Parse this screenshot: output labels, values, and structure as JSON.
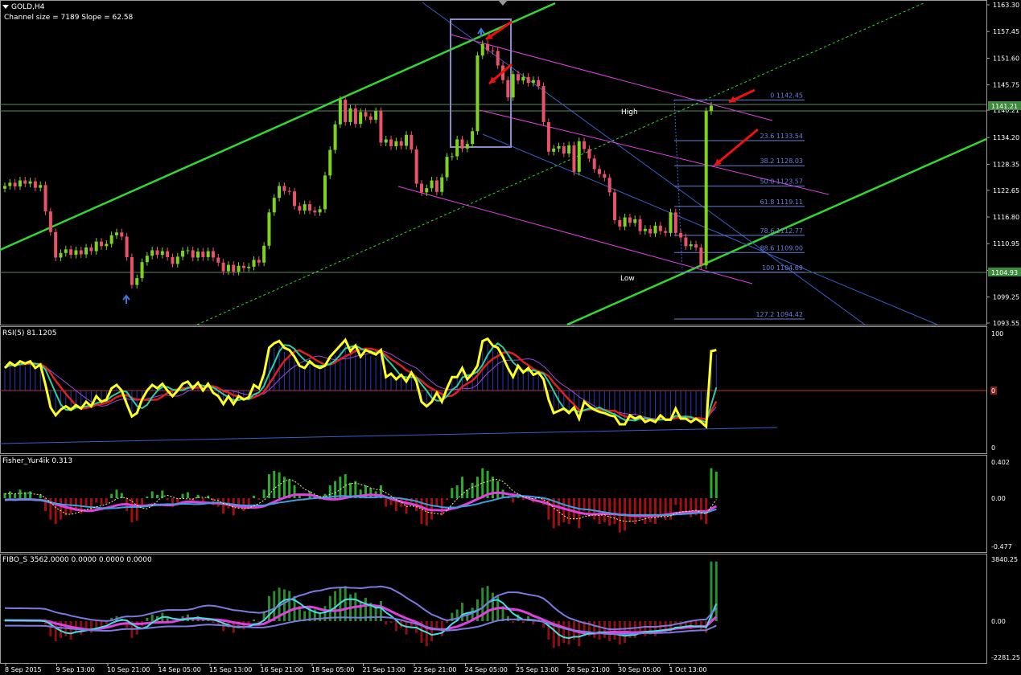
{
  "header": {
    "symbol": "GOLD,H4",
    "channel_info": "Channel size = 7189 Slope = 62.58"
  },
  "panels": {
    "rsi": {
      "title": "RSI(5) 81.1205",
      "ticks": [
        "100",
        "0"
      ],
      "mid_tag": "0"
    },
    "fisher": {
      "title": "Fisher_Yur4ik 0.313",
      "ticks": [
        "0.402",
        "0.00",
        "-0.477"
      ]
    },
    "fibo": {
      "title": "FIBO_S 3562.0000 0.0000 0.0000 0.0000",
      "ticks": [
        "3840.25",
        "0.00",
        "-2281.25"
      ]
    }
  },
  "price_labels": {
    "high": "High",
    "low": "Low",
    "current_tag": "1141.21",
    "low_tag": "1104.93"
  },
  "colors": {
    "bull": "#7ed31f",
    "bear": "#e8536a",
    "channel": "#31d831",
    "grid_line": "#5a8a5a",
    "rsi_main": "#ffff20",
    "fib": "#6a7fd8",
    "magenta": "#e040e0"
  },
  "chart_data": {
    "type": "line",
    "price_axis": {
      "ticks": [
        "1163.30",
        "1157.45",
        "1151.60",
        "1145.75",
        "1140.21",
        "1134.20",
        "1128.35",
        "1122.65",
        "1116.80",
        "1110.95",
        "1105.10",
        "1099.25",
        "1093.55"
      ],
      "ylim": [
        1093.55,
        1163.3
      ]
    },
    "time_axis": [
      "8 Sep 2015",
      "9 Sep 13:00",
      "10 Sep 21:00",
      "14 Sep 05:00",
      "15 Sep 13:00",
      "16 Sep 21:00",
      "18 Sep 05:00",
      "21 Sep 13:00",
      "22 Sep 21:00",
      "24 Sep 05:00",
      "25 Sep 13:00",
      "28 Sep 21:00",
      "30 Sep 05:00",
      "1 Oct 13:00"
    ],
    "fib_levels": [
      {
        "label": "0 1142.45",
        "value": 1142.45
      },
      {
        "label": "23.6 1133.54",
        "value": 1133.54
      },
      {
        "label": "38.2 1128.03",
        "value": 1128.03
      },
      {
        "label": "50.0 1123.57",
        "value": 1123.57
      },
      {
        "label": "61.8 1119.11",
        "value": 1119.11
      },
      {
        "label": "78.6 1112.77",
        "value": 1112.77
      },
      {
        "label": "88.6 1109.00",
        "value": 1109.0
      },
      {
        "label": "100 1104.69",
        "value": 1104.69
      },
      {
        "label": "127.2 1094.42",
        "value": 1094.42
      }
    ],
    "candles": [
      {
        "o": 1123.0,
        "c": 1123.6
      },
      {
        "o": 1123.6,
        "c": 1124.3
      },
      {
        "o": 1124.3,
        "c": 1123.5
      },
      {
        "o": 1123.5,
        "c": 1124.8
      },
      {
        "o": 1124.8,
        "c": 1124.1
      },
      {
        "o": 1124.1,
        "c": 1124.6
      },
      {
        "o": 1124.6,
        "c": 1123.2
      },
      {
        "o": 1123.2,
        "c": 1123.8
      },
      {
        "o": 1123.8,
        "c": 1118.0
      },
      {
        "o": 1118.0,
        "c": 1113.5
      },
      {
        "o": 1113.5,
        "c": 1107.9
      },
      {
        "o": 1107.9,
        "c": 1108.9
      },
      {
        "o": 1108.9,
        "c": 1109.7
      },
      {
        "o": 1109.7,
        "c": 1108.5
      },
      {
        "o": 1108.5,
        "c": 1109.5
      },
      {
        "o": 1109.5,
        "c": 1108.6
      },
      {
        "o": 1108.6,
        "c": 1110.1
      },
      {
        "o": 1110.1,
        "c": 1109.3
      },
      {
        "o": 1109.3,
        "c": 1111.4
      },
      {
        "o": 1111.4,
        "c": 1110.4
      },
      {
        "o": 1110.4,
        "c": 1110.9
      },
      {
        "o": 1110.9,
        "c": 1112.8
      },
      {
        "o": 1112.8,
        "c": 1113.4
      },
      {
        "o": 1113.4,
        "c": 1112.5
      },
      {
        "o": 1112.5,
        "c": 1108.0
      },
      {
        "o": 1108.0,
        "c": 1101.9
      },
      {
        "o": 1101.9,
        "c": 1103.4
      },
      {
        "o": 1103.4,
        "c": 1106.9
      },
      {
        "o": 1106.9,
        "c": 1108.3
      },
      {
        "o": 1108.3,
        "c": 1109.5
      },
      {
        "o": 1109.5,
        "c": 1108.5
      },
      {
        "o": 1108.5,
        "c": 1109.3
      },
      {
        "o": 1109.3,
        "c": 1108.0
      },
      {
        "o": 1108.0,
        "c": 1106.5
      },
      {
        "o": 1106.5,
        "c": 1108.1
      },
      {
        "o": 1108.1,
        "c": 1109.4
      },
      {
        "o": 1109.4,
        "c": 1109.5
      },
      {
        "o": 1109.5,
        "c": 1107.9
      },
      {
        "o": 1107.9,
        "c": 1109.2
      },
      {
        "o": 1109.2,
        "c": 1108.0
      },
      {
        "o": 1108.0,
        "c": 1109.3
      },
      {
        "o": 1109.3,
        "c": 1107.9
      },
      {
        "o": 1107.9,
        "c": 1106.8
      },
      {
        "o": 1106.8,
        "c": 1104.9
      },
      {
        "o": 1104.9,
        "c": 1106.3
      },
      {
        "o": 1106.3,
        "c": 1104.8
      },
      {
        "o": 1104.8,
        "c": 1106.1
      },
      {
        "o": 1106.1,
        "c": 1105.6
      },
      {
        "o": 1105.6,
        "c": 1105.9
      },
      {
        "o": 1105.9,
        "c": 1107.4
      },
      {
        "o": 1107.4,
        "c": 1106.8
      },
      {
        "o": 1106.8,
        "c": 1110.5
      },
      {
        "o": 1110.5,
        "c": 1117.8
      },
      {
        "o": 1117.8,
        "c": 1121.0
      },
      {
        "o": 1121.0,
        "c": 1123.6
      },
      {
        "o": 1123.6,
        "c": 1122.5
      },
      {
        "o": 1122.5,
        "c": 1122.4
      },
      {
        "o": 1122.4,
        "c": 1119.2
      },
      {
        "o": 1119.2,
        "c": 1118.2
      },
      {
        "o": 1118.2,
        "c": 1119.6
      },
      {
        "o": 1119.6,
        "c": 1118.2
      },
      {
        "o": 1118.2,
        "c": 1117.8
      },
      {
        "o": 1117.8,
        "c": 1118.5
      },
      {
        "o": 1118.5,
        "c": 1125.9
      },
      {
        "o": 1125.9,
        "c": 1131.5
      },
      {
        "o": 1131.5,
        "c": 1137.1
      },
      {
        "o": 1137.1,
        "c": 1142.5
      },
      {
        "o": 1142.5,
        "c": 1137.6
      },
      {
        "o": 1137.6,
        "c": 1140.6
      },
      {
        "o": 1140.6,
        "c": 1137.2
      },
      {
        "o": 1137.2,
        "c": 1139.8
      },
      {
        "o": 1139.8,
        "c": 1138.8
      },
      {
        "o": 1138.8,
        "c": 1138.1
      },
      {
        "o": 1138.1,
        "c": 1140.0
      },
      {
        "o": 1140.0,
        "c": 1133.1
      },
      {
        "o": 1133.1,
        "c": 1133.8
      },
      {
        "o": 1133.8,
        "c": 1132.3
      },
      {
        "o": 1132.3,
        "c": 1133.4
      },
      {
        "o": 1133.4,
        "c": 1132.4
      },
      {
        "o": 1132.4,
        "c": 1134.8
      },
      {
        "o": 1134.8,
        "c": 1131.6
      },
      {
        "o": 1131.6,
        "c": 1124.1
      },
      {
        "o": 1124.1,
        "c": 1122.2
      },
      {
        "o": 1122.2,
        "c": 1123.1
      },
      {
        "o": 1123.1,
        "c": 1124.8
      },
      {
        "o": 1124.8,
        "c": 1122.3
      },
      {
        "o": 1122.3,
        "c": 1125.5
      },
      {
        "o": 1125.5,
        "c": 1130.0
      },
      {
        "o": 1130.0,
        "c": 1130.1
      },
      {
        "o": 1130.1,
        "c": 1133.8
      },
      {
        "o": 1133.8,
        "c": 1131.8
      },
      {
        "o": 1131.8,
        "c": 1132.8
      },
      {
        "o": 1132.8,
        "c": 1135.6
      },
      {
        "o": 1135.6,
        "c": 1152.2
      },
      {
        "o": 1152.2,
        "c": 1154.7
      },
      {
        "o": 1154.7,
        "c": 1153.3
      },
      {
        "o": 1153.3,
        "c": 1153.2
      },
      {
        "o": 1153.2,
        "c": 1150.0
      },
      {
        "o": 1150.0,
        "c": 1146.8
      },
      {
        "o": 1146.8,
        "c": 1143.0
      },
      {
        "o": 1143.0,
        "c": 1148.1
      },
      {
        "o": 1148.1,
        "c": 1146.7
      },
      {
        "o": 1146.7,
        "c": 1147.5
      },
      {
        "o": 1147.5,
        "c": 1146.2
      },
      {
        "o": 1146.2,
        "c": 1146.8
      },
      {
        "o": 1146.8,
        "c": 1145.5
      },
      {
        "o": 1145.5,
        "c": 1137.6
      },
      {
        "o": 1137.6,
        "c": 1131.1
      },
      {
        "o": 1131.1,
        "c": 1131.8
      },
      {
        "o": 1131.8,
        "c": 1132.3
      },
      {
        "o": 1132.3,
        "c": 1130.7
      },
      {
        "o": 1130.7,
        "c": 1132.5
      },
      {
        "o": 1132.5,
        "c": 1126.7
      },
      {
        "o": 1126.7,
        "c": 1133.4
      },
      {
        "o": 1133.4,
        "c": 1131.7
      },
      {
        "o": 1131.7,
        "c": 1129.6
      },
      {
        "o": 1129.6,
        "c": 1127.3
      },
      {
        "o": 1127.3,
        "c": 1126.2
      },
      {
        "o": 1126.2,
        "c": 1125.4
      },
      {
        "o": 1125.4,
        "c": 1122.2
      },
      {
        "o": 1122.2,
        "c": 1116.1
      },
      {
        "o": 1116.1,
        "c": 1114.7
      },
      {
        "o": 1114.7,
        "c": 1116.7
      },
      {
        "o": 1116.7,
        "c": 1115.5
      },
      {
        "o": 1115.5,
        "c": 1116.3
      },
      {
        "o": 1116.3,
        "c": 1113.7
      },
      {
        "o": 1113.7,
        "c": 1114.2
      },
      {
        "o": 1114.2,
        "c": 1113.2
      },
      {
        "o": 1113.2,
        "c": 1114.9
      },
      {
        "o": 1114.9,
        "c": 1113.7
      },
      {
        "o": 1113.7,
        "c": 1113.3
      },
      {
        "o": 1113.3,
        "c": 1117.8
      },
      {
        "o": 1117.8,
        "c": 1113.3
      },
      {
        "o": 1113.3,
        "c": 1112.3
      },
      {
        "o": 1112.3,
        "c": 1110.4
      },
      {
        "o": 1110.4,
        "c": 1110.8
      },
      {
        "o": 1110.8,
        "c": 1110.1
      },
      {
        "o": 1110.1,
        "c": 1106.2
      },
      {
        "o": 1106.2,
        "c": 1140.0
      },
      {
        "o": 1140.0,
        "c": 1141.2
      }
    ],
    "rsi": [
      70,
      75,
      72,
      76,
      74,
      76,
      70,
      73,
      55,
      35,
      28,
      33,
      36,
      33,
      37,
      34,
      40,
      36,
      45,
      40,
      42,
      52,
      55,
      50,
      38,
      27,
      30,
      42,
      50,
      55,
      52,
      56,
      50,
      45,
      50,
      56,
      58,
      52,
      57,
      50,
      56,
      48,
      45,
      38,
      45,
      38,
      45,
      42,
      44,
      55,
      52,
      65,
      88,
      92,
      94,
      88,
      86,
      80,
      72,
      70,
      76,
      72,
      70,
      72,
      80,
      85,
      90,
      95,
      85,
      90,
      80,
      86,
      84,
      82,
      86,
      62,
      65,
      60,
      64,
      58,
      66,
      58,
      40,
      36,
      40,
      48,
      40,
      52,
      62,
      62,
      70,
      60,
      65,
      72,
      94,
      96,
      90,
      88,
      80,
      70,
      62,
      72,
      66,
      70,
      64,
      66,
      60,
      42,
      30,
      32,
      34,
      30,
      35,
      25,
      40,
      36,
      33,
      31,
      30,
      28,
      27,
      20,
      20,
      28,
      25,
      27,
      22,
      24,
      22,
      28,
      24,
      24,
      34,
      25,
      25,
      22,
      25,
      22,
      18,
      85,
      86
    ],
    "fisher": {
      "histogram": [
        0.06,
        0.08,
        0.05,
        0.1,
        0.07,
        0.08,
        -0.02,
        0.04,
        -0.15,
        -0.25,
        -0.3,
        -0.25,
        -0.2,
        -0.18,
        -0.15,
        -0.18,
        -0.1,
        -0.14,
        -0.05,
        -0.08,
        -0.06,
        0.05,
        0.1,
        0.06,
        -0.15,
        -0.28,
        -0.26,
        -0.1,
        0.02,
        0.08,
        0.04,
        0.09,
        -0.02,
        -0.1,
        -0.05,
        0.05,
        0.07,
        -0.04,
        0.04,
        -0.06,
        0.03,
        -0.08,
        -0.1,
        -0.18,
        -0.12,
        -0.2,
        -0.12,
        -0.15,
        -0.12,
        0.03,
        -0.02,
        0.1,
        0.28,
        0.32,
        0.3,
        0.25,
        0.22,
        0.15,
        0.05,
        -0.02,
        0.08,
        0.02,
        -0.02,
        0.05,
        0.15,
        0.2,
        0.25,
        0.28,
        0.18,
        0.2,
        0.1,
        0.15,
        0.12,
        0.08,
        0.15,
        -0.1,
        -0.08,
        -0.15,
        -0.1,
        -0.18,
        -0.05,
        -0.15,
        -0.3,
        -0.32,
        -0.25,
        -0.1,
        -0.2,
        -0.02,
        0.12,
        0.15,
        0.25,
        0.1,
        0.18,
        0.25,
        0.35,
        0.32,
        0.25,
        0.2,
        0.1,
        0.02,
        -0.05,
        0.05,
        -0.02,
        0.03,
        -0.05,
        0.02,
        -0.08,
        -0.25,
        -0.35,
        -0.32,
        -0.28,
        -0.3,
        -0.25,
        -0.35,
        -0.15,
        -0.22,
        -0.25,
        -0.3,
        -0.28,
        -0.32,
        -0.3,
        -0.4,
        -0.38,
        -0.28,
        -0.3,
        -0.25,
        -0.3,
        -0.28,
        -0.3,
        -0.22,
        -0.25,
        -0.25,
        -0.08,
        -0.2,
        -0.18,
        -0.22,
        -0.2,
        -0.25,
        -0.3,
        0.35,
        0.31
      ]
    },
    "fibo_s": {
      "histogram": [
        80,
        70,
        60,
        80,
        40,
        50,
        30,
        40,
        -200,
        -900,
        -1200,
        -1000,
        -900,
        -1100,
        -700,
        -800,
        -600,
        -700,
        -400,
        -300,
        -200,
        200,
        300,
        150,
        -400,
        -1000,
        -800,
        -300,
        200,
        400,
        300,
        500,
        200,
        -100,
        100,
        300,
        400,
        200,
        300,
        100,
        200,
        -100,
        -200,
        -600,
        -400,
        -700,
        -400,
        -500,
        -300,
        100,
        -100,
        600,
        1500,
        1800,
        2000,
        1900,
        1800,
        1500,
        900,
        600,
        900,
        700,
        500,
        900,
        1500,
        1800,
        2000,
        2100,
        1600,
        1700,
        1200,
        1400,
        1100,
        900,
        1200,
        -200,
        -100,
        -600,
        -400,
        -800,
        -300,
        -700,
        -1300,
        -1500,
        -1200,
        -400,
        -900,
        -100,
        500,
        700,
        1100,
        500,
        800,
        1300,
        2000,
        2100,
        1700,
        1500,
        900,
        300,
        -100,
        400,
        -100,
        300,
        -200,
        100,
        -400,
        -1100,
        -1600,
        -1500,
        -1300,
        -1400,
        -1100,
        -1500,
        -700,
        -900,
        -1000,
        -1100,
        -1000,
        -1200,
        -1100,
        -1400,
        -1300,
        -1000,
        -1000,
        -800,
        -900,
        -800,
        -900,
        -600,
        -700,
        -700,
        -200,
        -500,
        -400,
        -500,
        -400,
        -500,
        -700,
        3562,
        3562
      ]
    }
  }
}
